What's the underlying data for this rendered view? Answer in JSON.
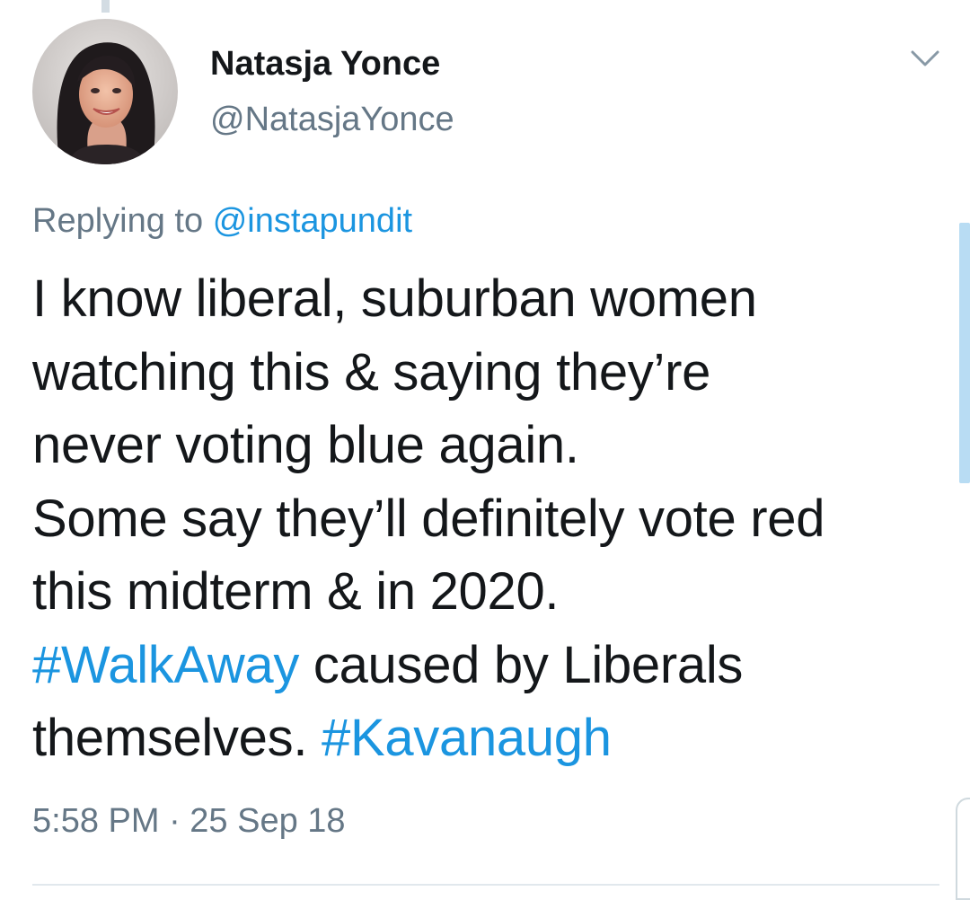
{
  "tweet": {
    "author": {
      "display_name": "Natasja Yonce",
      "handle": "@NatasjaYonce"
    },
    "reply_context": {
      "prefix": "Replying to",
      "mention": "@instapundit"
    },
    "text_lines": [
      "I know liberal, suburban women",
      "watching this & saying they’re",
      "never voting blue again.",
      "Some say they’ll definitely vote red",
      "this midterm & in 2020."
    ],
    "hashtag_1": "#WalkAway",
    "text_after_hashtag_1": " caused by Liberals",
    "text_before_hashtag_2": "themselves. ",
    "hashtag_2": "#Kavanaugh",
    "timestamp": "5:58 PM · 25 Sep 18"
  },
  "icons": {
    "menu": "chevron-down-icon",
    "avatar": "profile-photo"
  },
  "colors": {
    "link": "#1b95e0",
    "secondary_text": "#657786",
    "primary_text": "#14171a",
    "scrollbar": "#b8dcf3"
  }
}
